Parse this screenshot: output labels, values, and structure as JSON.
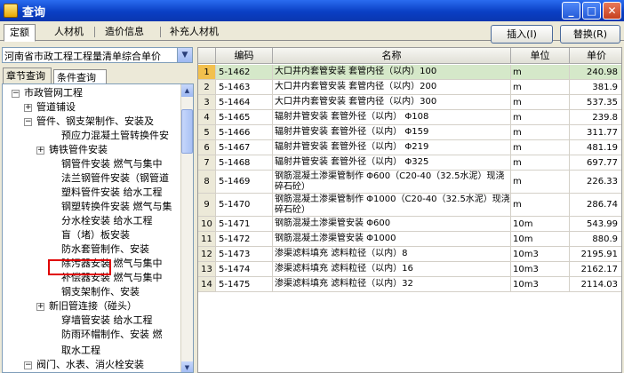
{
  "window": {
    "title": "查询"
  },
  "window_buttons": [
    "_",
    "□",
    "✕"
  ],
  "tabs": [
    "定额",
    "人材机",
    "造价信息",
    "补充人材机"
  ],
  "actions": {
    "insert": "插入(I)",
    "replace": "替换(R)"
  },
  "library_select": {
    "value": "河南省市政工程工程量清单综合单价"
  },
  "sub_tabs": [
    "章节查询",
    "条件查询"
  ],
  "tree": [
    {
      "label": "市政管网工程",
      "expander": "−"
    },
    {
      "label": "管道铺设",
      "expander": "+"
    },
    {
      "label": "管件、钢支架制作、安装及",
      "expander": "−"
    },
    {
      "label": "预应力混凝土管转换件安",
      "expander": ""
    },
    {
      "label": "铸铁管件安装",
      "expander": "+"
    },
    {
      "label": "钢管件安装 燃气与集中",
      "expander": ""
    },
    {
      "label": "法兰钢管件安装（钢管道",
      "expander": ""
    },
    {
      "label": "塑料管件安装 给水工程",
      "expander": ""
    },
    {
      "label": "钢塑转换件安装 燃气与集",
      "expander": ""
    },
    {
      "label": "分水栓安装 给水工程",
      "expander": ""
    },
    {
      "label": "盲（堵）板安装",
      "expander": ""
    },
    {
      "label": "防水套管制作、安装",
      "expander": ""
    },
    {
      "label": "除污器安装 燃气与集中",
      "expander": ""
    },
    {
      "label": "补偿器安装 燃气与集中",
      "expander": ""
    },
    {
      "label": "钢支架制作、安装",
      "expander": ""
    },
    {
      "label": "新旧管连接（碰头）",
      "expander": "+"
    },
    {
      "label": "穿墙管安装 给水工程",
      "expander": ""
    },
    {
      "label": "防雨环帽制作、安装 燃",
      "expander": ""
    },
    {
      "label": "取水工程",
      "expander": ""
    },
    {
      "label": "阀门、水表、消火栓安装",
      "expander": "−"
    }
  ],
  "table": {
    "headers": {
      "index": "",
      "code": "编码",
      "name": "名称",
      "unit": "单位",
      "price": "单价"
    },
    "rows": [
      {
        "idx": "1",
        "code": "5-1462",
        "name": "大口井内套管安装 套管内径（以内）100",
        "unit": "m",
        "price": "240.98"
      },
      {
        "idx": "2",
        "code": "5-1463",
        "name": "大口井内套管安装 套管内径（以内）200",
        "unit": "m",
        "price": "381.9"
      },
      {
        "idx": "3",
        "code": "5-1464",
        "name": "大口井内套管安装 套管内径（以内）300",
        "unit": "m",
        "price": "537.35"
      },
      {
        "idx": "4",
        "code": "5-1465",
        "name": "辐射井管安装 套管外径（以内） Φ108",
        "unit": "m",
        "price": "239.8"
      },
      {
        "idx": "5",
        "code": "5-1466",
        "name": "辐射井管安装 套管外径（以内） Φ159",
        "unit": "m",
        "price": "311.77"
      },
      {
        "idx": "6",
        "code": "5-1467",
        "name": "辐射井管安装 套管外径（以内） Φ219",
        "unit": "m",
        "price": "481.19"
      },
      {
        "idx": "7",
        "code": "5-1468",
        "name": "辐射井管安装 套管外径（以内） Φ325",
        "unit": "m",
        "price": "697.77"
      },
      {
        "idx": "8",
        "code": "5-1469",
        "name": "钢筋混凝土渗渠管制作 Φ600（C20-40（32.5水泥）现浇碎石砼）",
        "unit": "m",
        "price": "226.33"
      },
      {
        "idx": "9",
        "code": "5-1470",
        "name": "钢筋混凝土渗渠管制作 Φ1000（C20-40（32.5水泥）现浇碎石砼）",
        "unit": "m",
        "price": "286.74"
      },
      {
        "idx": "10",
        "code": "5-1471",
        "name": "钢筋混凝土渗渠管安装 Φ600",
        "unit": "10m",
        "price": "543.99"
      },
      {
        "idx": "11",
        "code": "5-1472",
        "name": "钢筋混凝土渗渠管安装 Φ1000",
        "unit": "10m",
        "price": "880.9"
      },
      {
        "idx": "12",
        "code": "5-1473",
        "name": "渗渠滤料填充 滤料粒径（以内）8",
        "unit": "10m3",
        "price": "2195.91"
      },
      {
        "idx": "13",
        "code": "5-1474",
        "name": "渗渠滤料填充 滤料粒径（以内）16",
        "unit": "10m3",
        "price": "2162.17"
      },
      {
        "idx": "14",
        "code": "5-1475",
        "name": "渗渠滤料填充 滤料粒径（以内）32",
        "unit": "10m3",
        "price": "2114.03"
      }
    ],
    "selected_row": "1"
  },
  "colors": {
    "title_bar": "#0a3fc4",
    "selected_row": "#d5e8c9",
    "selected_index": "#f2c04e",
    "highlight_box": "#e00000"
  }
}
